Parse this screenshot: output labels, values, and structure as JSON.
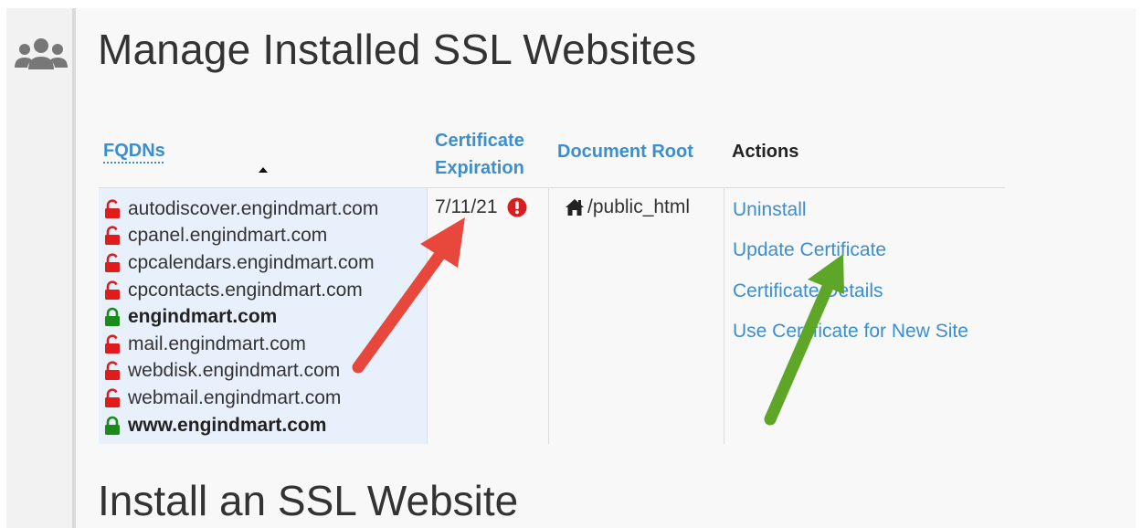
{
  "page": {
    "title": "Manage Installed SSL Websites",
    "section_title": "Install an SSL Website"
  },
  "table": {
    "headers": {
      "fqdns": "FQDNs",
      "cert_line1": "Certificate",
      "cert_line2": "Expiration",
      "document_root": "Document Root",
      "actions": "Actions"
    },
    "fqdns": [
      {
        "name": "autodiscover.engindmart.com",
        "status": "insecure"
      },
      {
        "name": "cpanel.engindmart.com",
        "status": "insecure"
      },
      {
        "name": "cpcalendars.engindmart.com",
        "status": "insecure"
      },
      {
        "name": "cpcontacts.engindmart.com",
        "status": "insecure"
      },
      {
        "name": "engindmart.com",
        "status": "secure"
      },
      {
        "name": "mail.engindmart.com",
        "status": "insecure"
      },
      {
        "name": "webdisk.engindmart.com",
        "status": "insecure"
      },
      {
        "name": "webmail.engindmart.com",
        "status": "insecure"
      },
      {
        "name": "www.engindmart.com",
        "status": "secure"
      }
    ],
    "expiration": "7/11/21",
    "document_root": "/public_html",
    "actions": [
      "Uninstall",
      "Update Certificate",
      "Certificate Details",
      "Use Certificate for New Site"
    ]
  },
  "icons": {
    "sidebar": "users-group-icon",
    "insecure_lock": "unlocked-icon",
    "secure_lock": "locked-icon",
    "warning": "warning-icon",
    "home": "home-icon"
  },
  "colors": {
    "link": "#3b8ed0",
    "insecure": "#e01b1b",
    "secure": "#1a8a1a",
    "red_arrow": "#e8483b",
    "green_arrow": "#5ea628"
  }
}
